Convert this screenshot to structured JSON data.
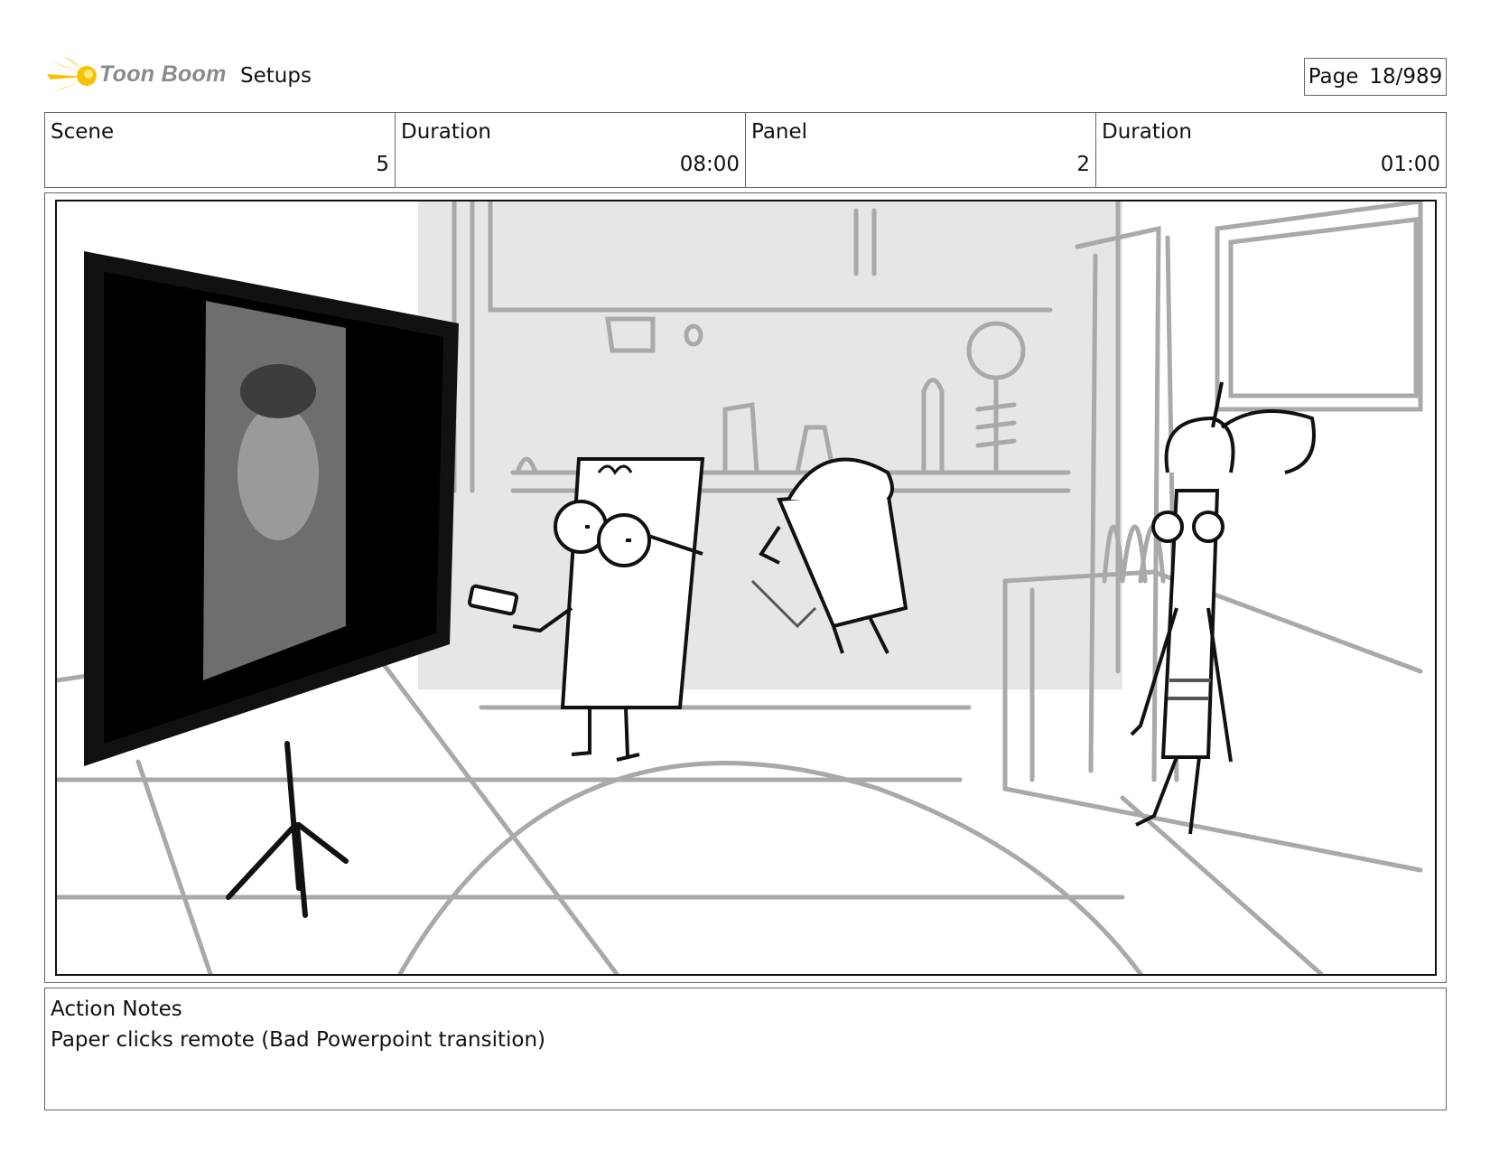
{
  "header": {
    "logo_text": "Toon Boom",
    "title": "Setups",
    "page_label": "Page",
    "page_value": "18/989"
  },
  "info": {
    "scene_label": "Scene",
    "scene_value": "5",
    "duration_label": "Duration",
    "duration_value": "08:00",
    "panel_label": "Panel",
    "panel_value": "2",
    "panel_duration_label": "Duration",
    "panel_duration_value": "01:00"
  },
  "notes": {
    "label": "Action Notes",
    "text": "Paper clicks remote (Bad Powerpoint transition)"
  },
  "colors": {
    "logo_spark": "#f5c400",
    "sketch_grey": "#a9a9a9",
    "backdrop_grey": "#e6e6e6"
  }
}
